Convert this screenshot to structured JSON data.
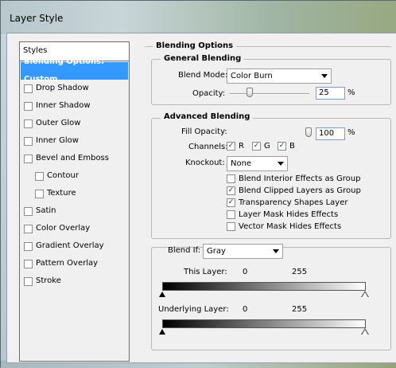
{
  "window": {
    "title": "Layer Style"
  },
  "styles_panel": {
    "header": "Styles",
    "items": [
      {
        "label": "Blending Options: Custom",
        "selected": true,
        "has_checkbox": false,
        "checked": false,
        "indent": false
      },
      {
        "label": "Drop Shadow",
        "selected": false,
        "has_checkbox": true,
        "checked": false,
        "indent": false
      },
      {
        "label": "Inner Shadow",
        "selected": false,
        "has_checkbox": true,
        "checked": false,
        "indent": false
      },
      {
        "label": "Outer Glow",
        "selected": false,
        "has_checkbox": true,
        "checked": false,
        "indent": false
      },
      {
        "label": "Inner Glow",
        "selected": false,
        "has_checkbox": true,
        "checked": false,
        "indent": false
      },
      {
        "label": "Bevel and Emboss",
        "selected": false,
        "has_checkbox": true,
        "checked": false,
        "indent": false
      },
      {
        "label": "Contour",
        "selected": false,
        "has_checkbox": true,
        "checked": false,
        "indent": true
      },
      {
        "label": "Texture",
        "selected": false,
        "has_checkbox": true,
        "checked": false,
        "indent": true
      },
      {
        "label": "Satin",
        "selected": false,
        "has_checkbox": true,
        "checked": false,
        "indent": false
      },
      {
        "label": "Color Overlay",
        "selected": false,
        "has_checkbox": true,
        "checked": false,
        "indent": false
      },
      {
        "label": "Gradient Overlay",
        "selected": false,
        "has_checkbox": true,
        "checked": false,
        "indent": false
      },
      {
        "label": "Pattern Overlay",
        "selected": false,
        "has_checkbox": true,
        "checked": false,
        "indent": false
      },
      {
        "label": "Stroke",
        "selected": false,
        "has_checkbox": true,
        "checked": false,
        "indent": false
      }
    ]
  },
  "blending_options": {
    "title": "Blending Options",
    "general": {
      "title": "General Blending",
      "blend_mode_label": "Blend Mode:",
      "blend_mode_value": "Color Burn",
      "opacity_label": "Opacity:",
      "opacity_value": "25",
      "opacity_unit": "%",
      "opacity_fraction": 0.25
    },
    "advanced": {
      "title": "Advanced Blending",
      "fill_opacity_label": "Fill Opacity:",
      "fill_opacity_value": "100",
      "fill_opacity_unit": "%",
      "fill_opacity_fraction": 1.0,
      "channels_label": "Channels:",
      "channels": [
        {
          "label": "R",
          "checked": true
        },
        {
          "label": "G",
          "checked": true
        },
        {
          "label": "B",
          "checked": true
        }
      ],
      "knockout_label": "Knockout:",
      "knockout_value": "None",
      "options": [
        {
          "label": "Blend Interior Effects as Group",
          "checked": false
        },
        {
          "label": "Blend Clipped Layers as Group",
          "checked": true
        },
        {
          "label": "Transparency Shapes Layer",
          "checked": true
        },
        {
          "label": "Layer Mask Hides Effects",
          "checked": false
        },
        {
          "label": "Vector Mask Hides Effects",
          "checked": false
        }
      ]
    },
    "blend_if": {
      "label": "Blend If:",
      "value": "Gray",
      "this_layer_label": "This Layer:",
      "this_layer_min": "0",
      "this_layer_max": "255",
      "underlying_label": "Underlying Layer:",
      "underlying_min": "0",
      "underlying_max": "255"
    }
  },
  "colors": {
    "selection": "#3399ff",
    "panel": "#f0f0f0"
  }
}
